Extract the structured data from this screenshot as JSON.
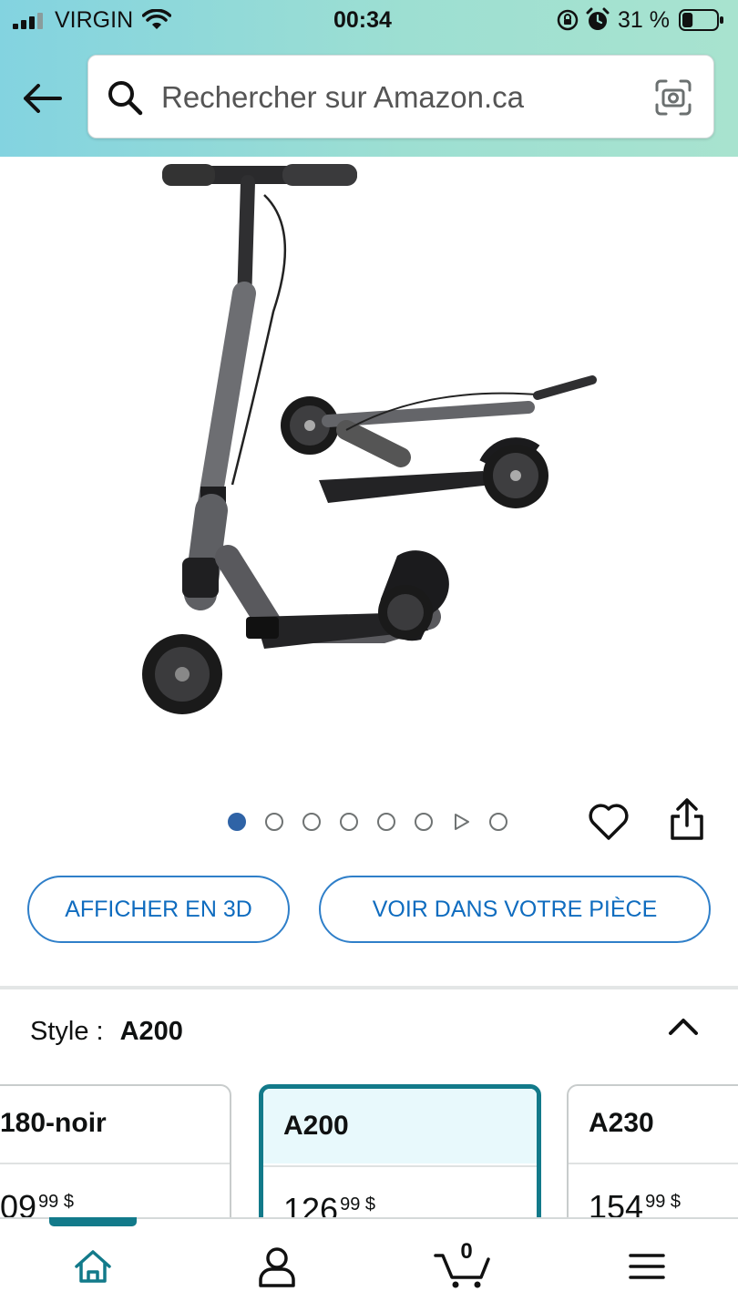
{
  "status_bar": {
    "carrier": "VIRGIN",
    "time": "00:34",
    "battery_percent": "31 %",
    "battery_level": 0.31
  },
  "header": {
    "back_icon": "arrow-left-icon",
    "search": {
      "placeholder": "Rechercher sur Amazon.ca",
      "value": ""
    },
    "camera_icon": "camera-scan-icon"
  },
  "product": {
    "image_icon": "kick-scooter-image",
    "carousel": {
      "total_dots": 7,
      "active_index": 0,
      "video_index": 6
    }
  },
  "actions": {
    "view_3d": "AFFICHER EN 3D",
    "view_in_room": "VOIR DANS VOTRE PIÈCE"
  },
  "style": {
    "label": "Style :",
    "selected": "A200",
    "options": [
      {
        "name": "180-noir",
        "price_main": "09",
        "price_cents": "99",
        "currency": "$"
      },
      {
        "name": "A200",
        "price_main": "126",
        "price_cents": "99",
        "currency": "$"
      },
      {
        "name": "A230",
        "price_main": "154",
        "price_cents": "99",
        "currency": "$"
      }
    ]
  },
  "bottom_nav": {
    "items": [
      "home-icon",
      "account-icon",
      "cart-icon",
      "menu-icon"
    ],
    "cart_count": "0",
    "active": "home-icon"
  },
  "colors": {
    "accent": "#127a8a",
    "link_blue": "#0f6cbf",
    "dot_active": "#2f63a6"
  }
}
